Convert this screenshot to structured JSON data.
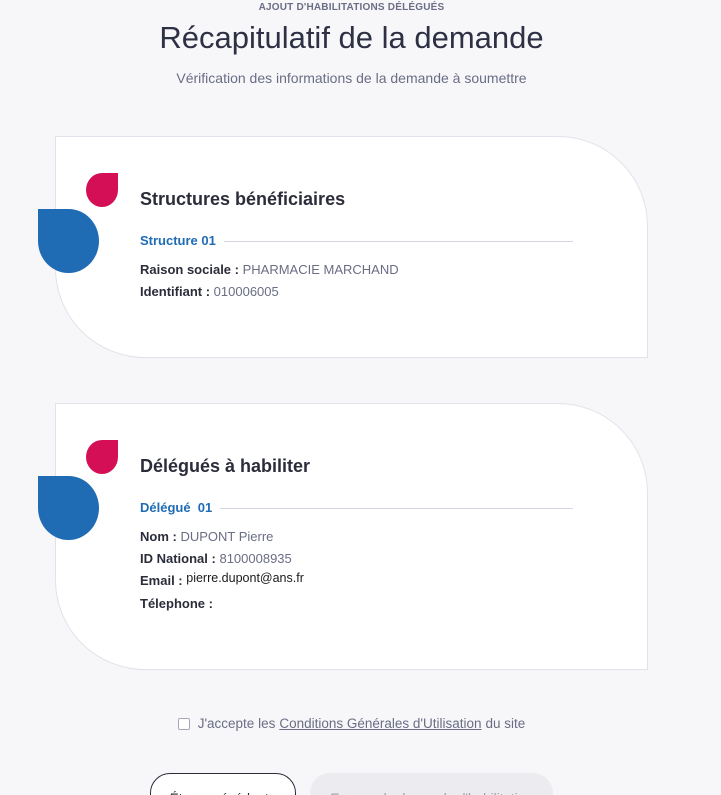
{
  "header": {
    "overline": "AJOUT D'HABILITATIONS DÉLÉGUÉS",
    "title": "Récapitulatif de la demande",
    "subtitle": "Vérification des informations de la demande à soumettre"
  },
  "structures": {
    "title": "Structures bénéficiaires",
    "section_label": "Structure 01",
    "raison_sociale_label": "Raison sociale :",
    "raison_sociale_value": "PHARMACIE MARCHAND",
    "identifiant_label": "Identifiant :",
    "identifiant_value": "010006005"
  },
  "delegues": {
    "title": "Délégués à habiliter",
    "section_label": "Délégué  01",
    "nom_label": "Nom :",
    "nom_value": "DUPONT Pierre",
    "id_national_label": "ID National :",
    "id_national_value": "8100008935",
    "email_label": "Email :",
    "email_value": "pierre.dupont@ans.fr",
    "telephone_label": "Télephone :"
  },
  "terms": {
    "prefix": "J'accepte les",
    "link": "Conditions Générales d'Utilisation",
    "suffix": "du site",
    "checked": false
  },
  "buttons": {
    "previous": "Étape précédente",
    "send": "Envoyer la demande d'habilitation"
  },
  "colors": {
    "accent_blue": "#1f6cb5",
    "accent_red": "#d40f55"
  }
}
